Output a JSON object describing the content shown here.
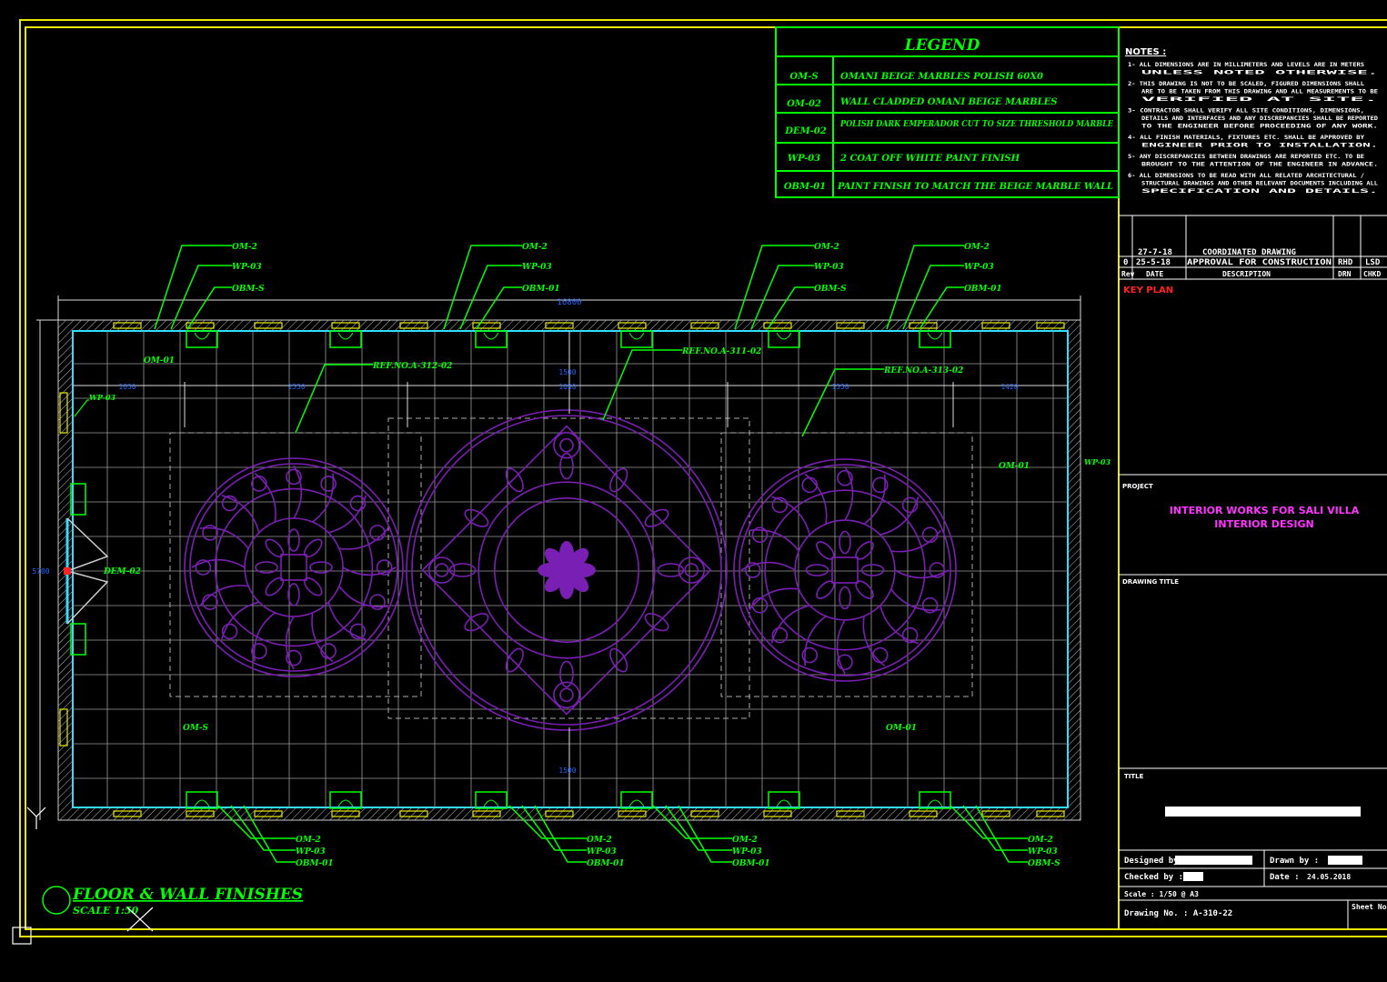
{
  "colors": {
    "border": "#e8e800",
    "green": "#00ff00",
    "purple": "#7a1fb3",
    "cyan": "#33ddff",
    "white": "#ffffff",
    "red": "#ff2222",
    "magenta": "#ff33ff",
    "grey": "#cfcfcf"
  },
  "legend": {
    "title": "LEGEND",
    "rows": [
      {
        "code": "OM-S",
        "desc": "OMANI BEIGE MARBLES POLISH 60X0"
      },
      {
        "code": "OM-02",
        "desc": "WALL CLADDED OMANI BEIGE MARBLES"
      },
      {
        "code": "DEM-02",
        "desc": "POLISH DARK EMPERADOR CUT TO SIZE THRESHOLD MARBLE"
      },
      {
        "code": "WP-03",
        "desc": "2 COAT OFF WHITE PAINT FINISH"
      },
      {
        "code": "OBM-01",
        "desc": "PAINT FINISH TO MATCH THE BEIGE MARBLE WALL"
      }
    ]
  },
  "notes": {
    "title": "NOTES :",
    "items": [
      "1- ALL DIMENSIONS ARE IN MILLIMETERS AND LEVELS ARE IN METERS UNLESS NOTED OTHERWISE.",
      "2- THIS DRAWING IS NOT TO BE SCALED, FIGURED DIMENSIONS SHALL ARE TO BE TAKEN FROM THIS DRAWING AND ALL MEASUREMENTS TO BE VERIFIED AT SITE.",
      "3- CONTRACTOR SHALL VERIFY ALL SITE CONDITIONS, DIMENSIONS, DETAILS AND INTERFACES AND ANY DISCREPANCIES SHALL BE REPORTED TO THE ENGINEER BEFORE PROCEEDING OF ANY WORK.",
      "4- ALL FINISH MATERIALS, FIXTURES ETC. SHALL BE APPROVED BY ENGINEER PRIOR TO INSTALLATION.",
      "5- ANY DISCREPANCIES BETWEEN DRAWINGS ARE REPORTED ETC. TO BE BROUGHT TO THE ATTENTION OF THE ENGINEER IN ADVANCE.",
      "6- ALL DIMENSIONS TO BE READ WITH ALL RELATED ARCHITECTURAL / STRUCTURAL DRAWINGS AND OTHER RELEVANT DOCUMENTS INCLUDING ALL SPECIFICATION AND DETAILS."
    ]
  },
  "revisions": {
    "rows": [
      {
        "rev": "",
        "date": "27-7-18",
        "desc": "COORDINATED DRAWING",
        "drn": "",
        "chk": ""
      },
      {
        "rev": "0",
        "date": "25-5-18",
        "desc": "APPROVAL FOR CONSTRUCTION",
        "drn": "RHD",
        "chk": "LSD"
      }
    ],
    "header": {
      "rev": "Rev",
      "date": "DATE",
      "desc": "DESCRIPTION",
      "drn": "DRN",
      "chk": "CHKD"
    }
  },
  "key_plan": "KEY PLAN",
  "project": {
    "label": "PROJECT",
    "line1": "INTERIOR WORKS FOR SALI VILLA",
    "line2": "INTERIOR DESIGN"
  },
  "drawing_title_label": "DRAWING TITLE",
  "title_label": "TITLE",
  "title_block": {
    "designed_by": "Designed by :",
    "drawn_by": "Drawn by :",
    "checked_by": "Checked by :",
    "date_label": "Date :",
    "date_value": "24.05.2018",
    "scale": "Scale : 1/50 @ A3",
    "drawing_no": "Drawing No. :  A-310-22",
    "sheet_no": "Sheet No."
  },
  "plan": {
    "title": "FLOOR & WALL FINISHES",
    "scale": "SCALE 1:50",
    "overall_dim": "16800",
    "left_dim": "5700",
    "dims": [
      "1650",
      "1550",
      "1500",
      "1650",
      "1550",
      "1420",
      "1500"
    ],
    "refs": [
      "REF.NO.A-312-02",
      "REF.NO.A-311-02",
      "REF.NO.A-313-02"
    ],
    "room_labels": [
      "OM-01",
      "OM-01",
      "OM-S",
      "OM-01"
    ],
    "door_label": "DEM-02",
    "left_wall_label": "WP-03",
    "right_wall_label": "WP-03",
    "top_callouts": [
      [
        "OM-2",
        "WP-03",
        "OBM-S"
      ],
      [
        "OM-2",
        "WP-03",
        "OBM-01"
      ],
      [
        "OM-2",
        "WP-03",
        "OBM-S"
      ],
      [
        "OM-2",
        "WP-03",
        "OBM-01"
      ]
    ],
    "bottom_callouts": [
      [
        "OM-2",
        "WP-03",
        "OBM-01"
      ],
      [
        "OM-2",
        "WP-03",
        "OBM-01"
      ],
      [
        "OM-2",
        "WP-03",
        "OBM-01"
      ],
      [
        "OM-2",
        "WP-03",
        "OBM-S"
      ]
    ]
  }
}
